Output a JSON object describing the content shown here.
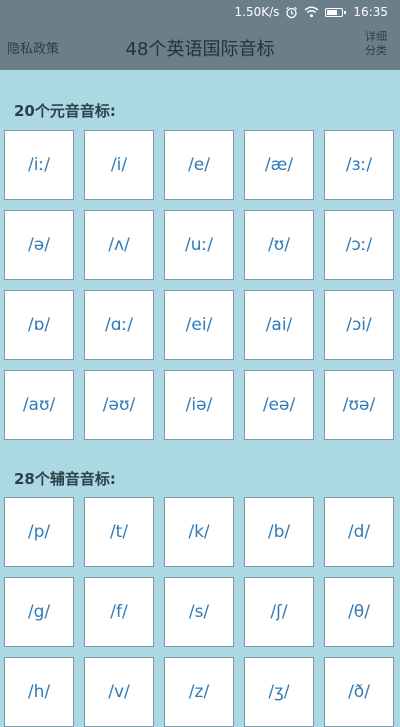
{
  "status_bar": {
    "speed": "1.50K/s",
    "time": "16:35",
    "icons": [
      "alarm-icon",
      "wifi-icon",
      "battery-icon"
    ]
  },
  "app_bar": {
    "left_label": "隐私政策",
    "title": "48个英语国际音标",
    "right_label_line1": "详细",
    "right_label_line2": "分类"
  },
  "vowels": {
    "title": "20个元音音标:",
    "items": [
      "/iː/",
      "/i/",
      "/e/",
      "/æ/",
      "/ɜː/",
      "/ə/",
      "/ʌ/",
      "/uː/",
      "/ʊ/",
      "/ɔː/",
      "/ɒ/",
      "/ɑː/",
      "/ei/",
      "/ai/",
      "/ɔi/",
      "/aʊ/",
      "/əʊ/",
      "/iə/",
      "/eə/",
      "/ʊə/"
    ]
  },
  "consonants": {
    "title": "28个辅音音标:",
    "items": [
      "/p/",
      "/t/",
      "/k/",
      "/b/",
      "/d/",
      "/g/",
      "/f/",
      "/s/",
      "/ʃ/",
      "/θ/",
      "/h/",
      "/v/",
      "/z/",
      "/ʒ/",
      "/ð/"
    ]
  },
  "colors": {
    "background": "#acd8e4",
    "app_bar": "#6b7f8a",
    "symbol_text": "#2f7bb8"
  }
}
